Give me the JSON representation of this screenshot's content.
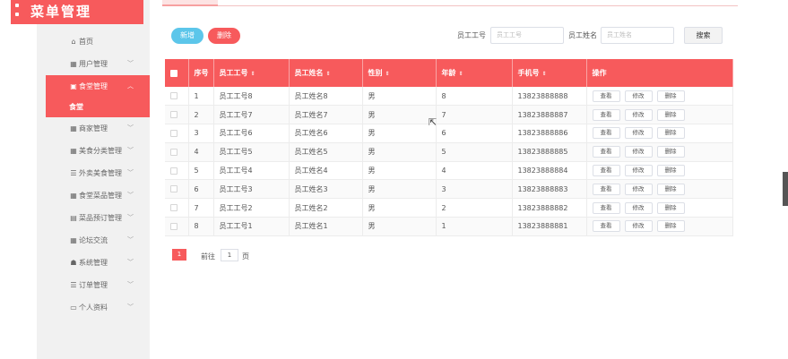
{
  "app": {
    "title": "菜单管理"
  },
  "sidebar": {
    "items": [
      {
        "label": "首页",
        "icon": "home-icon",
        "glyph": "⌂",
        "chevron": false
      },
      {
        "label": "用户管理",
        "icon": "grid-icon",
        "glyph": "▦",
        "chevron": true
      },
      {
        "label": "食堂管理",
        "icon": "document-icon",
        "glyph": "▣",
        "chevron": true,
        "active": true,
        "sub": "食堂"
      },
      {
        "label": "商家管理",
        "icon": "grid-icon",
        "glyph": "▦",
        "chevron": true
      },
      {
        "label": "美食分类管理",
        "icon": "grid-icon",
        "glyph": "▦",
        "chevron": true
      },
      {
        "label": "外卖美食管理",
        "icon": "list-icon",
        "glyph": "☰",
        "chevron": true
      },
      {
        "label": "食堂菜品管理",
        "icon": "grid-icon",
        "glyph": "▦",
        "chevron": true
      },
      {
        "label": "菜品预订管理",
        "icon": "table-icon",
        "glyph": "▤",
        "chevron": true
      },
      {
        "label": "论坛交流",
        "icon": "grid-icon",
        "glyph": "▦",
        "chevron": true
      },
      {
        "label": "系统管理",
        "icon": "layers-icon",
        "glyph": "☗",
        "chevron": true
      },
      {
        "label": "订单管理",
        "icon": "sliders-icon",
        "glyph": "☰",
        "chevron": true
      },
      {
        "label": "个人资料",
        "icon": "profile-icon",
        "glyph": "▭",
        "chevron": true
      }
    ]
  },
  "toolbar": {
    "add_label": "新增",
    "delete_label": "删除",
    "emp_no_label": "员工工号",
    "emp_no_placeholder": "员工工号",
    "emp_name_label": "员工姓名",
    "emp_name_placeholder": "员工姓名",
    "search_label": "搜索"
  },
  "table": {
    "headers": [
      "序号",
      "员工工号",
      "员工姓名",
      "性别",
      "年龄",
      "手机号",
      "操作"
    ],
    "rows": [
      [
        "1",
        "员工工号8",
        "员工姓名8",
        "男",
        "8",
        "13823888888"
      ],
      [
        "2",
        "员工工号7",
        "员工姓名7",
        "男",
        "7",
        "13823888887"
      ],
      [
        "3",
        "员工工号6",
        "员工姓名6",
        "男",
        "6",
        "13823888886"
      ],
      [
        "4",
        "员工工号5",
        "员工姓名5",
        "男",
        "5",
        "13823888885"
      ],
      [
        "5",
        "员工工号4",
        "员工姓名4",
        "男",
        "4",
        "13823888884"
      ],
      [
        "6",
        "员工工号3",
        "员工姓名3",
        "男",
        "3",
        "13823888883"
      ],
      [
        "7",
        "员工工号2",
        "员工姓名2",
        "男",
        "2",
        "13823888882"
      ],
      [
        "8",
        "员工工号1",
        "员工姓名1",
        "男",
        "1",
        "13823888881"
      ]
    ],
    "actions": [
      "查看",
      "修改",
      "删除"
    ]
  },
  "pagination": {
    "current_page": "1",
    "goto_prefix": "前往",
    "goto_value": "1",
    "goto_suffix": "页"
  },
  "colors": {
    "accent": "#f75a5c",
    "add_button": "#5cc6ea"
  }
}
